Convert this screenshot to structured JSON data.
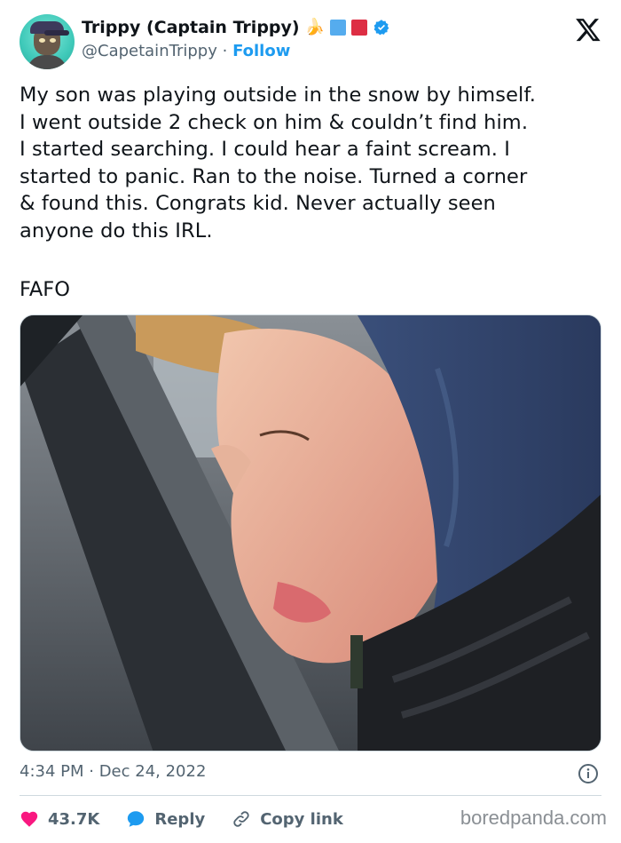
{
  "author": {
    "display_name": "Trippy (Captain Trippy)",
    "handle": "@CapetainTrippy",
    "separator": "·",
    "follow_label": "Follow",
    "emojis": [
      "banana",
      "blue-square",
      "red-square"
    ],
    "verified": true
  },
  "tweet": {
    "lines": [
      "My son was playing outside in the snow by himself.",
      "I went outside 2 check on him & couldn’t find him.",
      "I started searching. I could hear a faint scream. I",
      "started to panic. Ran to the noise. Turned a corner",
      "& found this. Congrats kid. Never actually seen",
      "anyone do this IRL."
    ],
    "closing": "FAFO",
    "timestamp": "4:34 PM · Dec 24, 2022"
  },
  "actions": {
    "likes": "43.7K",
    "reply_label": "Reply",
    "copy_link_label": "Copy link"
  },
  "watermark": "boredpanda.com",
  "colors": {
    "accent": "#1d9bf0",
    "like": "#f91880",
    "text_primary": "#0f1419",
    "text_secondary": "#536471"
  }
}
